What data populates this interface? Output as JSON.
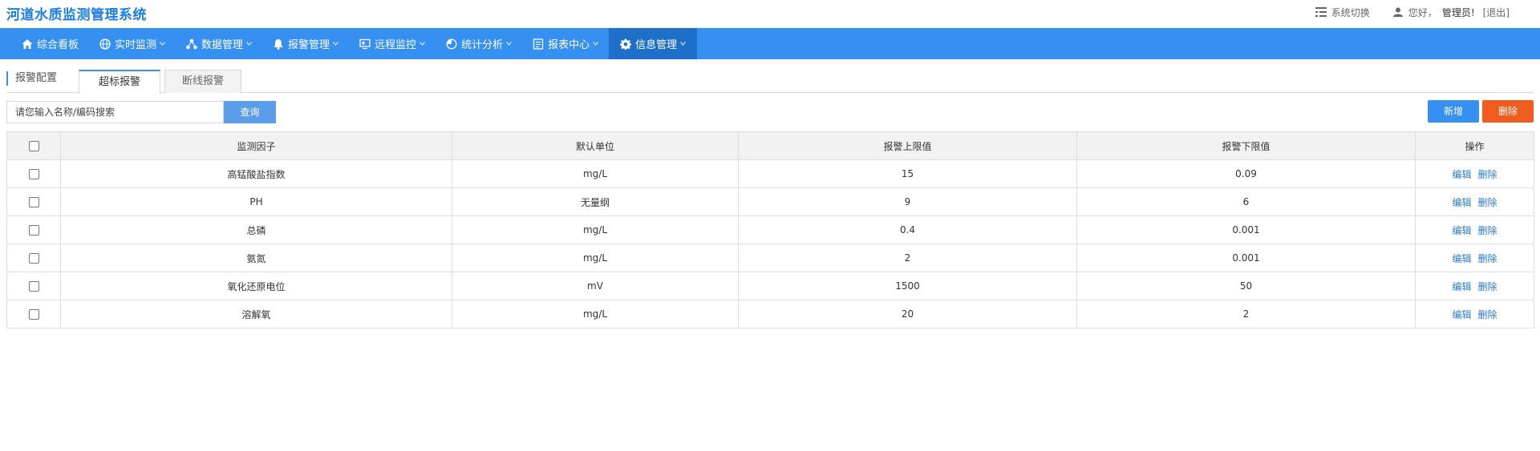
{
  "header": {
    "app_title": "河道水质监测管理系统",
    "switch_label": "系统切换",
    "greeting": "您好，",
    "user_name": "管理员!",
    "logout_label": "[退出]"
  },
  "nav": {
    "items": [
      {
        "label": "综合看板",
        "icon": "home-icon",
        "has_chevron": false
      },
      {
        "label": "实时监测",
        "icon": "globe-icon",
        "has_chevron": true
      },
      {
        "label": "数据管理",
        "icon": "network-icon",
        "has_chevron": true
      },
      {
        "label": "报警管理",
        "icon": "bell-icon",
        "has_chevron": true
      },
      {
        "label": "远程监控",
        "icon": "monitor-icon",
        "has_chevron": true
      },
      {
        "label": "统计分析",
        "icon": "pie-chart-icon",
        "has_chevron": true
      },
      {
        "label": "报表中心",
        "icon": "report-icon",
        "has_chevron": true
      },
      {
        "label": "信息管理",
        "icon": "gear-icon",
        "has_chevron": true,
        "active": true
      }
    ]
  },
  "tabs": {
    "section_label": "报警配置",
    "items": [
      "超标报警",
      "断线报警"
    ],
    "active_index": 0
  },
  "toolbar": {
    "search_placeholder": "请您输入名称/编码搜索",
    "query_label": "查询",
    "add_label": "新增",
    "delete_label": "删除"
  },
  "table": {
    "columns": [
      "监测因子",
      "默认单位",
      "报警上限值",
      "报警下限值",
      "操作"
    ],
    "edit_label": "编辑",
    "delete_label": "删除",
    "rows": [
      {
        "factor": "高锰酸盐指数",
        "unit": "mg/L",
        "upper": "15",
        "lower": "0.09"
      },
      {
        "factor": "PH",
        "unit": "无量纲",
        "upper": "9",
        "lower": "6"
      },
      {
        "factor": "总磷",
        "unit": "mg/L",
        "upper": "0.4",
        "lower": "0.001"
      },
      {
        "factor": "氨氮",
        "unit": "mg/L",
        "upper": "2",
        "lower": "0.001"
      },
      {
        "factor": "氧化还原电位",
        "unit": "mV",
        "upper": "1500",
        "lower": "50"
      },
      {
        "factor": "溶解氧",
        "unit": "mg/L",
        "upper": "20",
        "lower": "2"
      }
    ]
  },
  "colors": {
    "primary": "#3590f2",
    "nav_active": "#1e6fc9",
    "danger": "#f05b1e",
    "link": "#2b79d4"
  }
}
